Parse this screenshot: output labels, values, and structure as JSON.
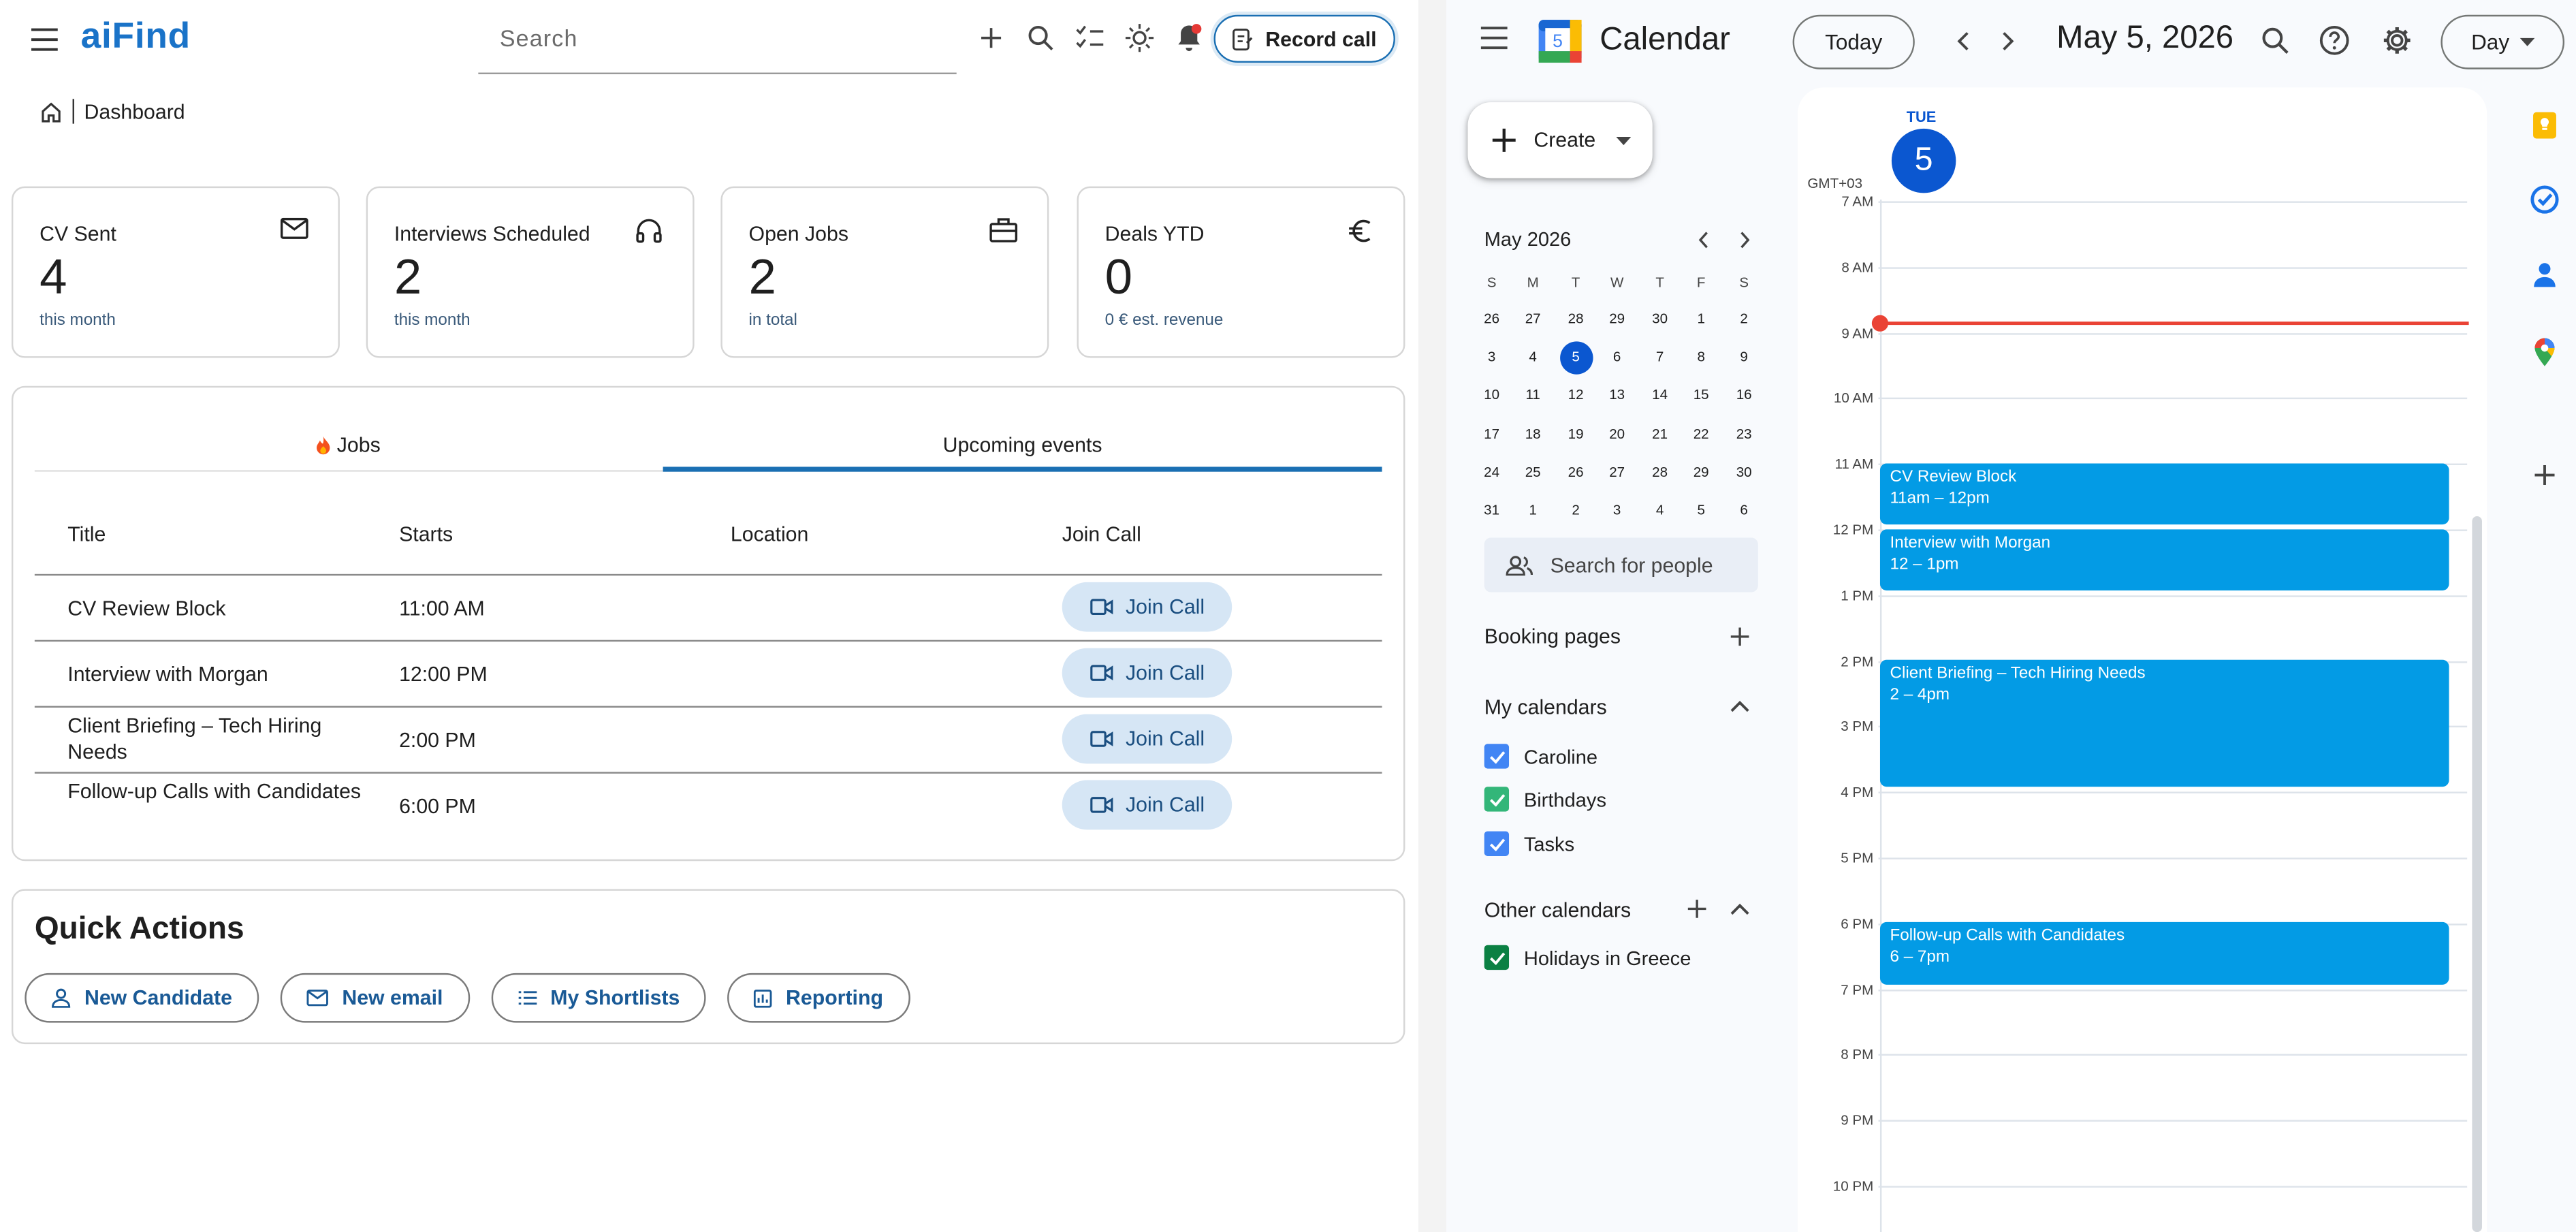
{
  "aifind": {
    "logo": "aiFind",
    "search_placeholder": "Search",
    "record_call": "Record call",
    "breadcrumb": "Dashboard",
    "cards": [
      {
        "label": "CV Sent",
        "value": "4",
        "sub": "this month",
        "icon": "mail-icon"
      },
      {
        "label": "Interviews Scheduled",
        "value": "2",
        "sub": "this month",
        "icon": "headset-icon"
      },
      {
        "label": "Open Jobs",
        "value": "2",
        "sub": "in total",
        "icon": "briefcase-icon"
      },
      {
        "label": "Deals YTD",
        "value": "0",
        "sub": "0 € est. revenue",
        "icon": "euro-icon"
      }
    ],
    "tabs": {
      "jobs": "Jobs",
      "events": "Upcoming events"
    },
    "table": {
      "headers": [
        "Title",
        "Starts",
        "Location",
        "Join Call"
      ],
      "rows": [
        {
          "title": "CV Review Block",
          "starts": "11:00 AM",
          "location": "",
          "action": "Join Call"
        },
        {
          "title": "Interview with Morgan",
          "starts": "12:00 PM",
          "location": "",
          "action": "Join Call"
        },
        {
          "title": "Client Briefing – Tech Hiring Needs",
          "starts": "2:00 PM",
          "location": "",
          "action": "Join Call"
        },
        {
          "title": "Follow-up Calls with Candidates",
          "starts": "6:00 PM",
          "location": "",
          "action": "Join Call"
        }
      ]
    },
    "quick_actions": {
      "title": "Quick Actions",
      "buttons": [
        "New Candidate",
        "New email",
        "My Shortlists",
        "Reporting"
      ]
    }
  },
  "gcal": {
    "title": "Calendar",
    "logo_day": "5",
    "today": "Today",
    "date": "May 5, 2026",
    "view": "Day",
    "create": "Create",
    "mini": {
      "title": "May 2026",
      "dow": [
        "S",
        "M",
        "T",
        "W",
        "T",
        "F",
        "S"
      ],
      "weeks": [
        [
          "26",
          "27",
          "28",
          "29",
          "30",
          "1",
          "2"
        ],
        [
          "3",
          "4",
          "5",
          "6",
          "7",
          "8",
          "9"
        ],
        [
          "10",
          "11",
          "12",
          "13",
          "14",
          "15",
          "16"
        ],
        [
          "17",
          "18",
          "19",
          "20",
          "21",
          "22",
          "23"
        ],
        [
          "24",
          "25",
          "26",
          "27",
          "28",
          "29",
          "30"
        ],
        [
          "31",
          "1",
          "2",
          "3",
          "4",
          "5",
          "6"
        ]
      ]
    },
    "search_people": "Search for people",
    "booking_pages": "Booking pages",
    "my_calendars": "My calendars",
    "my_calendar_items": [
      {
        "name": "Caroline",
        "color": "#4285f4"
      },
      {
        "name": "Birthdays",
        "color": "#33b679"
      },
      {
        "name": "Tasks",
        "color": "#4285f4"
      }
    ],
    "other_calendars": "Other calendars",
    "other_calendar_items": [
      {
        "name": "Holidays in Greece",
        "color": "#0b8043"
      }
    ],
    "day_header": {
      "dow": "TUE",
      "day": "5"
    },
    "timezone": "GMT+03",
    "hours": [
      "7 AM",
      "8 AM",
      "9 AM",
      "10 AM",
      "11 AM",
      "12 PM",
      "1 PM",
      "2 PM",
      "3 PM",
      "4 PM",
      "5 PM",
      "6 PM",
      "7 PM",
      "8 PM",
      "9 PM",
      "10 PM"
    ],
    "events": [
      {
        "title": "CV Review Block",
        "time": "11am – 12pm"
      },
      {
        "title": "Interview with Morgan",
        "time": "12 – 1pm"
      },
      {
        "title": "Client Briefing – Tech Hiring Needs",
        "time": "2 – 4pm"
      },
      {
        "title": "Follow-up Calls with Candidates",
        "time": "6 – 7pm"
      }
    ],
    "event_color": "#039be5"
  }
}
